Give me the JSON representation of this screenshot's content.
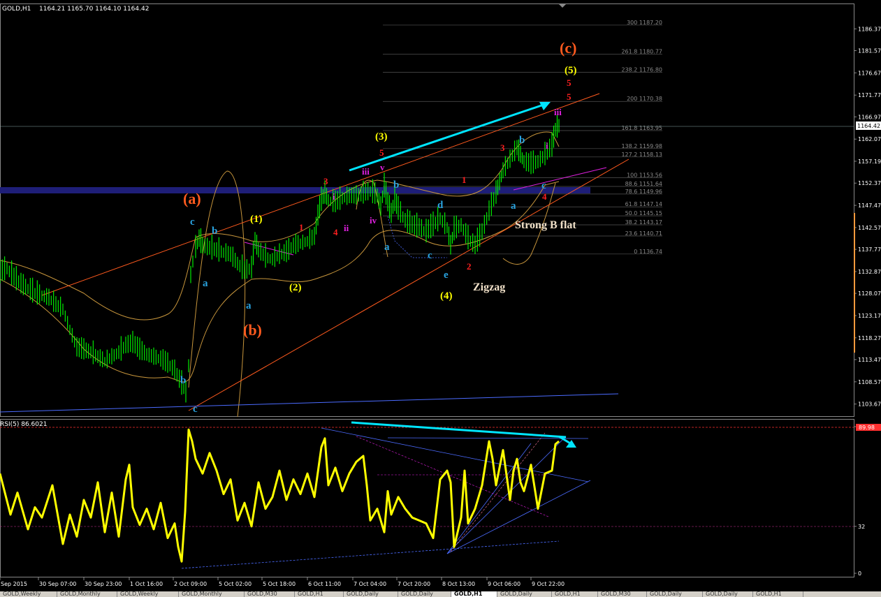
{
  "header": {
    "symbol": "GOLD,H1",
    "quote": "1164.21 1165.70 1164.10 1164.42"
  },
  "rsi_header": "RSI(5) 86.6021",
  "current_price_label": "1164.42",
  "colors": {
    "candles": "#00ff00",
    "rsi": "#ffff00",
    "bands": "#c8963c",
    "channel": "#ff5a1e",
    "arrow": "#00e5ff",
    "zone": "#1e1e78"
  },
  "chart_data": [
    {
      "type": "line",
      "name": "price",
      "ylim": [
        1101.0,
        1191.5
      ],
      "y_ticks": [
        "1186.37",
        "1181.57",
        "1176.67",
        "1171.77",
        "1166.97",
        "1162.07",
        "1157.19",
        "1152.37",
        "1147.47",
        "1142.57",
        "1137.77",
        "1132.87",
        "1128.07",
        "1123.17",
        "1118.27",
        "1113.47",
        "1108.57",
        "1103.67"
      ],
      "x_ticks": [
        "Sep 2015",
        "30 Sep 07:00",
        "30 Sep 23:00",
        "1 Oct 16:00",
        "2 Oct 09:00",
        "5 Oct 02:00",
        "5 Oct 18:00",
        "6 Oct 11:00",
        "7 Oct 04:00",
        "7 Oct 20:00",
        "8 Oct 13:00",
        "9 Oct 06:00",
        "9 Oct 22:00"
      ],
      "x": [
        0,
        10,
        20,
        30,
        40,
        50,
        60,
        70,
        80,
        90,
        100,
        110,
        120,
        130,
        140,
        150,
        160,
        170,
        180,
        190,
        200,
        210,
        220,
        230,
        240,
        250,
        260,
        266,
        270,
        273,
        276,
        280,
        285,
        290,
        300,
        310,
        320,
        330,
        340,
        350,
        360,
        365,
        370,
        380,
        390,
        400,
        410,
        420,
        430,
        440,
        450,
        455,
        460,
        465,
        470,
        480,
        490,
        500,
        510,
        520,
        530,
        540,
        545,
        550,
        555,
        560,
        565,
        570,
        580,
        590,
        600,
        610,
        620,
        630,
        640,
        645,
        650,
        660,
        670,
        680,
        690,
        700,
        710,
        715,
        720,
        730,
        740,
        745,
        750,
        760,
        770,
        780,
        790,
        795,
        800
      ],
      "values": [
        1132.5,
        1133.5,
        1131.5,
        1130.0,
        1129.0,
        1128.0,
        1127.5,
        1127.0,
        1125.5,
        1124.5,
        1120.0,
        1116.0,
        1115.5,
        1115.0,
        1114.0,
        1113.0,
        1114.0,
        1115.0,
        1116.5,
        1117.0,
        1115.5,
        1114.5,
        1114.0,
        1113.5,
        1112.5,
        1111.0,
        1108.0,
        1106.0,
        1112.0,
        1132.0,
        1135.0,
        1138.0,
        1140.0,
        1138.5,
        1138.0,
        1137.5,
        1137.0,
        1136.5,
        1134.5,
        1133.0,
        1133.5,
        1139.5,
        1137.5,
        1136.0,
        1135.5,
        1136.5,
        1137.0,
        1138.5,
        1139.0,
        1139.5,
        1140.5,
        1145.0,
        1148.5,
        1150.0,
        1148.5,
        1148.0,
        1149.0,
        1149.5,
        1149.5,
        1150.0,
        1150.5,
        1149.5,
        1147.0,
        1151.5,
        1148.0,
        1145.5,
        1148.5,
        1146.5,
        1144.0,
        1143.0,
        1142.5,
        1141.5,
        1143.0,
        1144.5,
        1142.5,
        1138.5,
        1142.0,
        1143.0,
        1140.0,
        1138.5,
        1141.5,
        1146.0,
        1150.0,
        1152.5,
        1155.0,
        1157.5,
        1160.0,
        1158.5,
        1157.0,
        1156.5,
        1157.0,
        1158.5,
        1160.5,
        1164.0,
        1165.0
      ],
      "fibonacci": [
        {
          "label": "300 1187.20",
          "value": 1187.2
        },
        {
          "label": "261.8 1180.77",
          "value": 1180.77
        },
        {
          "label": "238.2 1176.80",
          "value": 1176.8
        },
        {
          "label": "200 1170.38",
          "value": 1170.38
        },
        {
          "label": "161.8 1163.95",
          "value": 1163.95
        },
        {
          "label": "138.2 1159.98",
          "value": 1159.98
        },
        {
          "label": "127.2 1158.13",
          "value": 1158.13
        },
        {
          "label": "100 1153.56",
          "value": 1153.56
        },
        {
          "label": "88.6 1151.64",
          "value": 1151.64
        },
        {
          "label": "78.6 1149.96",
          "value": 1149.96
        },
        {
          "label": "61.8 1147.14",
          "value": 1147.14
        },
        {
          "label": "50.0 1145.15",
          "value": 1145.15
        },
        {
          "label": "38.2 1143.17",
          "value": 1143.17
        },
        {
          "label": "23.6 1140.71",
          "value": 1140.71
        },
        {
          "label": "0 1136.74",
          "value": 1136.74
        }
      ],
      "annotations": [
        {
          "text": "(a)",
          "color": "#ff5a1e",
          "size": 22
        },
        {
          "text": "(b)",
          "color": "#ff5a1e",
          "size": 22
        },
        {
          "text": "(c)",
          "color": "#ff5a1e",
          "size": 22
        },
        {
          "text": "(1)",
          "color": "#ffff00",
          "size": 15
        },
        {
          "text": "(2)",
          "color": "#ffff00",
          "size": 15
        },
        {
          "text": "(3)",
          "color": "#ffff00",
          "size": 15
        },
        {
          "text": "(4)",
          "color": "#ffff00",
          "size": 15
        },
        {
          "text": "(5)",
          "color": "#ffff00",
          "size": 15
        },
        {
          "text": "a",
          "color": "#29a3e0",
          "size": 15
        },
        {
          "text": "b",
          "color": "#29a3e0",
          "size": 15
        },
        {
          "text": "c",
          "color": "#29a3e0",
          "size": 15
        },
        {
          "text": "a",
          "color": "#29a3e0",
          "size": 15
        },
        {
          "text": "b",
          "color": "#29a3e0",
          "size": 15
        },
        {
          "text": "c",
          "color": "#29a3e0",
          "size": 15
        },
        {
          "text": "b",
          "color": "#29a3e0",
          "size": 15
        },
        {
          "text": "a",
          "color": "#29a3e0",
          "size": 15
        },
        {
          "text": "c",
          "color": "#29a3e0",
          "size": 15
        },
        {
          "text": "d",
          "color": "#29a3e0",
          "size": 15
        },
        {
          "text": "e",
          "color": "#29a3e0",
          "size": 15
        },
        {
          "text": "a",
          "color": "#29a3e0",
          "size": 15
        },
        {
          "text": "b",
          "color": "#29a3e0",
          "size": 15
        },
        {
          "text": "c",
          "color": "#29a3e0",
          "size": 15
        },
        {
          "text": "1",
          "color": "#ff2020",
          "size": 13
        },
        {
          "text": "3",
          "color": "#ff2020",
          "size": 13
        },
        {
          "text": "4",
          "color": "#ff2020",
          "size": 13
        },
        {
          "text": "5",
          "color": "#ff2020",
          "size": 13
        },
        {
          "text": "1",
          "color": "#ff2020",
          "size": 13
        },
        {
          "text": "2",
          "color": "#ff2020",
          "size": 13
        },
        {
          "text": "3",
          "color": "#ff2020",
          "size": 13
        },
        {
          "text": "4",
          "color": "#ff2020",
          "size": 13
        },
        {
          "text": "5",
          "color": "#ff2020",
          "size": 13
        },
        {
          "text": "5",
          "color": "#ff2020",
          "size": 13
        },
        {
          "text": "i",
          "color": "#e020e0",
          "size": 13
        },
        {
          "text": "ii",
          "color": "#e020e0",
          "size": 13
        },
        {
          "text": "iii",
          "color": "#e020e0",
          "size": 13
        },
        {
          "text": "iv",
          "color": "#e020e0",
          "size": 13
        },
        {
          "text": "v",
          "color": "#e020e0",
          "size": 13
        },
        {
          "text": "i",
          "color": "#e020e0",
          "size": 13
        },
        {
          "text": "iii",
          "color": "#e020e0",
          "size": 13
        },
        {
          "text": "Strong B flat",
          "color": "#f0e0c8",
          "size": 16
        },
        {
          "text": "Zigzag",
          "color": "#f0e0c8",
          "size": 16
        }
      ]
    },
    {
      "type": "line",
      "name": "RSI(5)",
      "ylim": [
        0,
        100
      ],
      "y_ticks": [
        "100",
        "32",
        "0"
      ],
      "level_label": "89.98",
      "x": [
        0,
        15,
        25,
        40,
        50,
        60,
        75,
        90,
        100,
        110,
        120,
        130,
        140,
        150,
        160,
        170,
        180,
        185,
        190,
        200,
        210,
        220,
        230,
        240,
        250,
        255,
        260,
        265,
        270,
        275,
        280,
        290,
        300,
        310,
        320,
        330,
        340,
        350,
        360,
        370,
        380,
        390,
        400,
        410,
        420,
        430,
        440,
        450,
        460,
        465,
        470,
        480,
        490,
        500,
        510,
        520,
        525,
        530,
        540,
        550,
        555,
        560,
        570,
        580,
        590,
        600,
        610,
        620,
        630,
        640,
        645,
        650,
        660,
        665,
        670,
        680,
        690,
        700,
        705,
        710,
        720,
        730,
        735,
        740,
        745,
        750,
        760,
        770,
        780,
        790,
        795,
        800
      ],
      "values": [
        68,
        40,
        55,
        30,
        45,
        38,
        60,
        20,
        40,
        25,
        50,
        38,
        62,
        28,
        55,
        25,
        64,
        74,
        45,
        33,
        44,
        30,
        48,
        24,
        34,
        18,
        8,
        42,
        98,
        90,
        78,
        68,
        82,
        70,
        54,
        64,
        36,
        48,
        32,
        62,
        44,
        52,
        70,
        50,
        64,
        54,
        68,
        52,
        86,
        92,
        60,
        72,
        56,
        68,
        76,
        80,
        60,
        36,
        44,
        28,
        56,
        40,
        52,
        44,
        38,
        36,
        34,
        24,
        64,
        70,
        62,
        18,
        38,
        70,
        34,
        44,
        60,
        90,
        78,
        60,
        84,
        50,
        70,
        78,
        62,
        56,
        74,
        44,
        68,
        70,
        88,
        90
      ]
    }
  ],
  "tabs": [
    {
      "label": "GOLD,Weekly",
      "active": false
    },
    {
      "label": "GOLD,Monthly",
      "active": false
    },
    {
      "label": "GOLD,Weekly",
      "active": false
    },
    {
      "label": "GOLD,Monthly",
      "active": false
    },
    {
      "label": "GOLD,M30",
      "active": false
    },
    {
      "label": "GOLD,H1",
      "active": false
    },
    {
      "label": "GOLD,Daily",
      "active": false
    },
    {
      "label": "GOLD,Daily",
      "active": false
    },
    {
      "label": "GOLD,H1",
      "active": true
    },
    {
      "label": "GOLD,Daily",
      "active": false
    },
    {
      "label": "GOLD,H1",
      "active": false
    },
    {
      "label": "GOLD,M30",
      "active": false
    },
    {
      "label": "GOLD,Daily",
      "active": false
    },
    {
      "label": "GOLD,Daily",
      "active": false
    },
    {
      "label": "GOLD,H1",
      "active": false
    }
  ]
}
